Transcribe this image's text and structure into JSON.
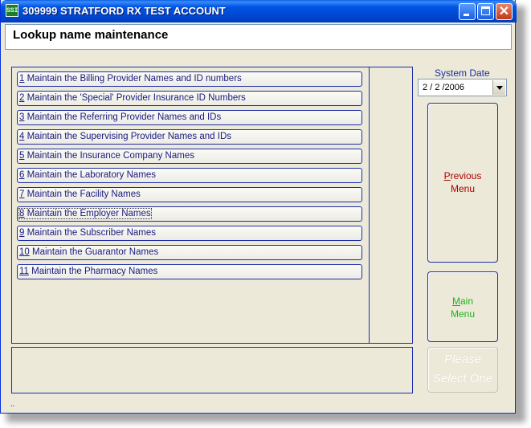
{
  "window": {
    "title": "309999 STRATFORD RX TEST ACCOUNT",
    "icon_text": "SSI",
    "icon": "app-logo-icon",
    "controls": {
      "minimize": "minimize-icon",
      "maximize": "maximize-icon",
      "close": "close-icon",
      "close_glyph": "✕"
    }
  },
  "header": {
    "title": "Lookup name maintenance"
  },
  "menu": {
    "items": [
      {
        "num": "1",
        "text": " Maintain the Billing Provider Names and ID numbers"
      },
      {
        "num": "2",
        "text": " Maintain the 'Special' Provider Insurance ID Numbers"
      },
      {
        "num": "3",
        "text": " Maintain the Referring Provider Names and IDs"
      },
      {
        "num": "4",
        "text": " Maintain the Supervising Provider Names and IDs"
      },
      {
        "num": "5",
        "text": " Maintain the Insurance Company Names"
      },
      {
        "num": "6",
        "text": " Maintain the Laboratory Names"
      },
      {
        "num": "7",
        "text": " Maintain the Facility Names"
      },
      {
        "num": "8",
        "text": " Maintain the Employer Names"
      },
      {
        "num": "9",
        "text": " Maintain the Subscriber Names"
      },
      {
        "num": "10",
        "text": " Maintain the Guarantor Names"
      },
      {
        "num": "11",
        "text": " Maintain the Pharmacy Names"
      }
    ],
    "focused_item": "8"
  },
  "system_date": {
    "label": "System Date",
    "value": "2 / 2 /2006"
  },
  "buttons": {
    "previous": {
      "underlined": "P",
      "rest": "revious",
      "line2": "Menu"
    },
    "main": {
      "underlined": "M",
      "rest": "ain",
      "line2": "Menu"
    },
    "select": {
      "line1": "Please",
      "line2": "Select One"
    }
  },
  "status": {
    "dots": ".."
  },
  "colors": {
    "titlebar": "#0055e5",
    "panel_border": "#1c2fa8",
    "menu_text": "#1a1a80",
    "previous_text": "#b00000",
    "main_text": "#1fb41f",
    "face": "#ece9d8"
  }
}
